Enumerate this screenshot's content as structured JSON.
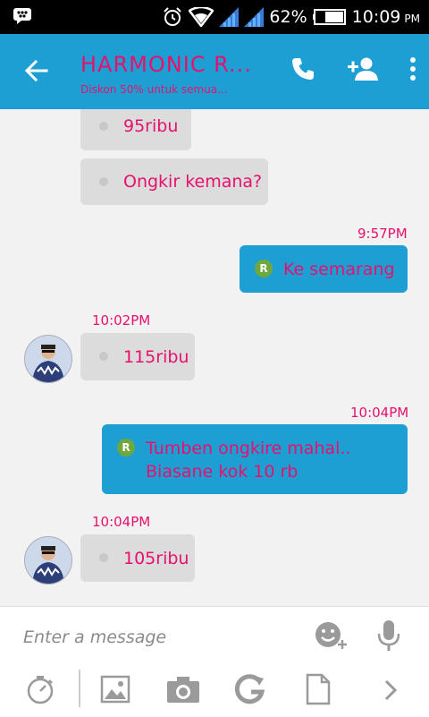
{
  "status": {
    "battery": "62%",
    "time": "10:09",
    "ampm": "PM"
  },
  "header": {
    "title": "HARMONIC R...",
    "subtitle": "Diskon 50% untuk semua..."
  },
  "messages": [
    {
      "text": "95ribu"
    },
    {
      "text": "Ongkir kemana?"
    },
    {
      "time": "9:57PM",
      "text": "Ke semarang",
      "badge": "R"
    },
    {
      "time": "10:02PM",
      "text": "115ribu"
    },
    {
      "time": "10:04PM",
      "line1": "Tumben ongkire mahal..",
      "line2": "Biasane kok 10 rb",
      "badge": "R"
    },
    {
      "time": "10:04PM",
      "text": "105ribu"
    }
  ],
  "composer": {
    "placeholder": "Enter a message"
  }
}
